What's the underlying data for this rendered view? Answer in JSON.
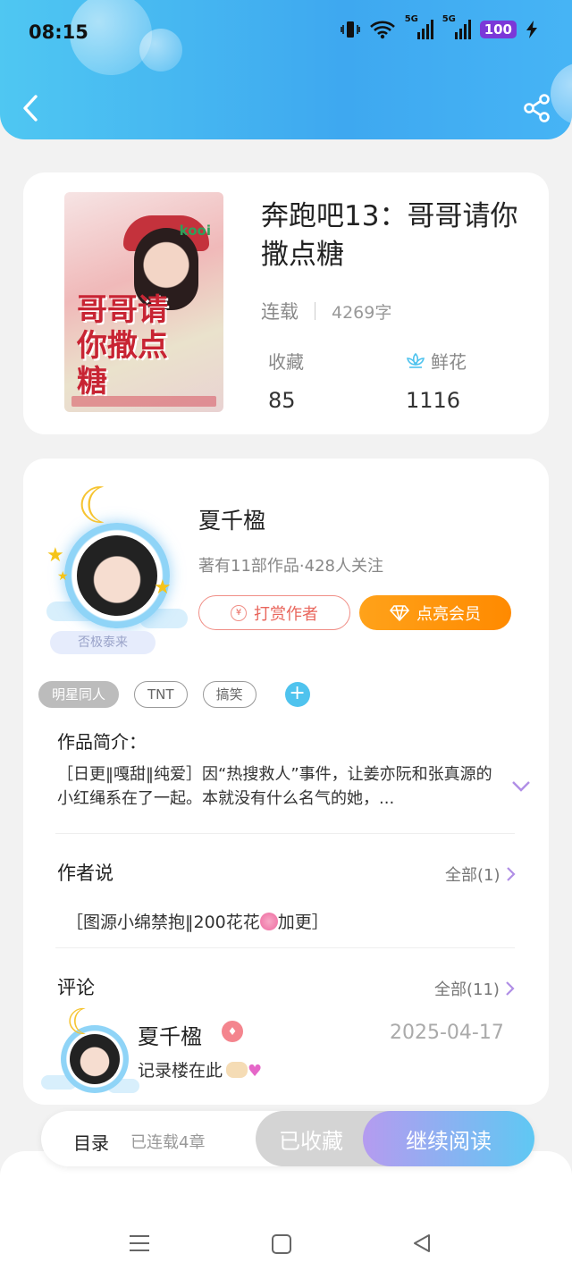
{
  "status_bar": {
    "time": "08:15",
    "battery": "100",
    "network1": "5G",
    "network2": "5G"
  },
  "book": {
    "title": "奔跑吧13：哥哥请你撒点糖",
    "cover_title": "哥哥请你撒点糖",
    "cover_brand": "kooi",
    "status": "连载",
    "word_count": "4269字",
    "favorites_label": "收藏",
    "favorites_value": "85",
    "flowers_label": "鲜花",
    "flowers_value": "1116"
  },
  "author": {
    "name": "夏千楹",
    "info": "著有11部作品·428人关注",
    "fan_badge": "否极泰来",
    "tip_label": "打赏作者",
    "vip_label": "点亮会员"
  },
  "tags": [
    "明星同人",
    "TNT",
    "搞笑"
  ],
  "summary": {
    "title": "作品简介：",
    "text": "［日更‖嘎甜‖纯爱］因“热搜救人”事件，让姜亦阮和张真源的小红绳系在了一起。本就没有什么名气的她，..."
  },
  "author_say": {
    "title": "作者说",
    "more": "全部(1)",
    "text_before": "［图源小绵禁抱‖200花花",
    "text_after": "加更］"
  },
  "comments": {
    "title": "评论",
    "more": "全部(11)",
    "items": [
      {
        "user": "夏千楹",
        "date": "2025-04-17",
        "text": "记录楼在此"
      }
    ]
  },
  "action_bar": {
    "toc": "目录",
    "toc_sub": "已连载4章",
    "collected": "已收藏",
    "continue": "继续阅读"
  },
  "colors": {
    "header": "#3ea8f0",
    "vip": "#ff9500",
    "accent": "#4fc3ee"
  }
}
